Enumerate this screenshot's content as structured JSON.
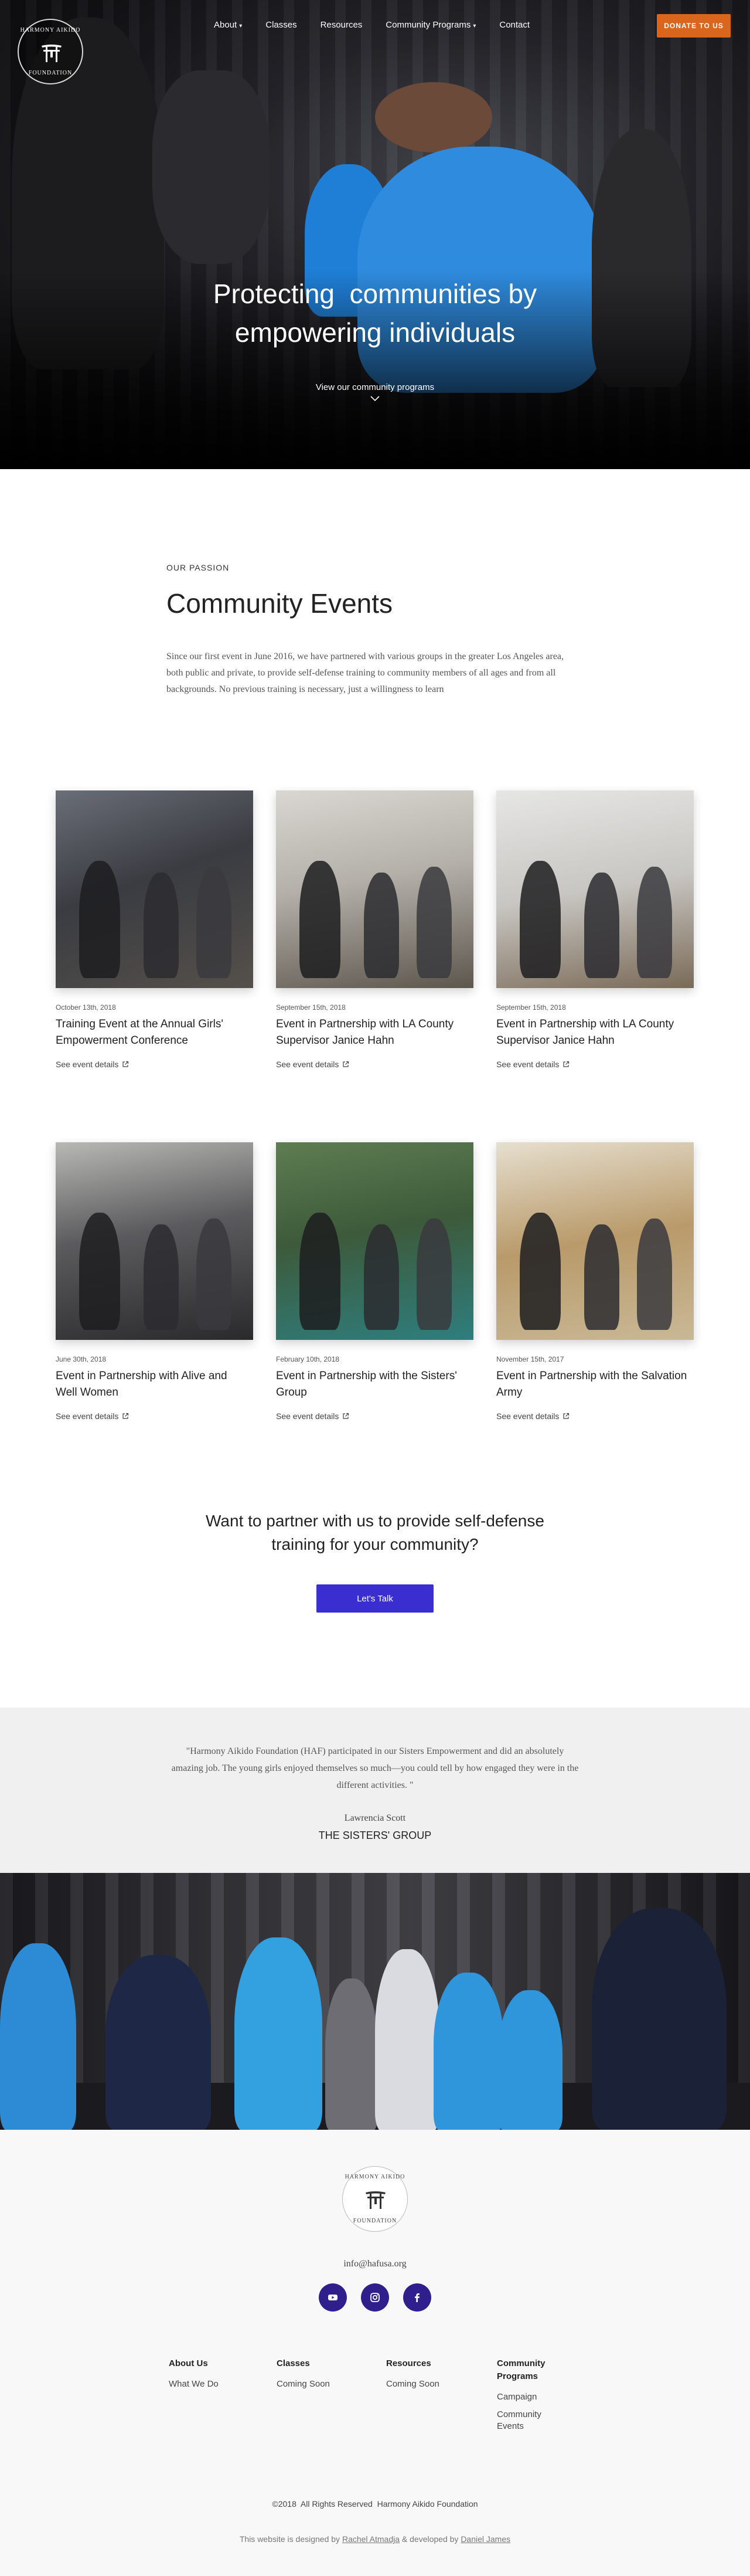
{
  "brand": {
    "logo_top": "HARMONY AIKIDO",
    "logo_bottom": "FOUNDATION"
  },
  "nav": {
    "items": [
      {
        "label": "About",
        "has_dropdown": true
      },
      {
        "label": "Classes",
        "has_dropdown": false
      },
      {
        "label": "Resources",
        "has_dropdown": false
      },
      {
        "label": "Community Programs",
        "has_dropdown": true
      },
      {
        "label": "Contact",
        "has_dropdown": false
      }
    ],
    "dropdown_glyph": "▾",
    "donate_label": "DONATE TO US",
    "donate_color": "#d9661c"
  },
  "hero": {
    "title_line1": "Protecting  communities by",
    "title_line2": "empowering individuals",
    "link_label": "View our community programs"
  },
  "events": {
    "kicker": "OUR PASSION",
    "title": "Community Events",
    "description": "Since our first event in June 2016, we have partnered with various groups in the greater Los Angeles area, both public and private, to provide self-defense training to community members of all ages and from all backgrounds. No previous training is necessary, just a willingness to learn",
    "more_label": "See event details",
    "cards": [
      {
        "date": "October 13th, 2018",
        "title": "Training Event at the Annual Girls' Empowerment Conference"
      },
      {
        "date": "September 15th, 2018",
        "title": "Event in Partnership with LA County Supervisor Janice Hahn"
      },
      {
        "date": "September 15th, 2018",
        "title": "Event in Partnership with LA County Supervisor Janice Hahn"
      },
      {
        "date": "June 30th, 2018",
        "title": "Event in Partnership with Alive and Well Women"
      },
      {
        "date": "February 10th, 2018",
        "title": "Event in Partnership with the Sisters' Group"
      },
      {
        "date": "November 15th, 2017",
        "title": "Event in Partnership with the Salvation Army"
      }
    ]
  },
  "cta": {
    "title_line1": "Want to partner with us to provide self-defense",
    "title_line2": "training for your community?",
    "button_label": "Let's Talk",
    "button_color": "#3b2ed0"
  },
  "testimonial": {
    "quote": "\"Harmony Aikido Foundation (HAF) participated in our Sisters Empowerment and did an absolutely amazing job. The young girls enjoyed themselves so much—you could tell by how engaged they were in the different activities. \"",
    "name": "Lawrencia Scott",
    "organization": "THE SISTERS' GROUP"
  },
  "footer": {
    "email": "info@hafusa.org",
    "socials": [
      {
        "name": "youtube-icon"
      },
      {
        "name": "instagram-icon"
      },
      {
        "name": "facebook-icon"
      }
    ],
    "social_color": "#2f1f8c",
    "columns": [
      {
        "heading": "About Us",
        "links": [
          "What We Do"
        ]
      },
      {
        "heading": "Classes",
        "links": [
          "Coming Soon"
        ]
      },
      {
        "heading": "Resources",
        "links": [
          "Coming Soon"
        ]
      },
      {
        "heading": "Community Programs",
        "links": [
          "Campaign",
          "Community Events"
        ]
      }
    ],
    "copyright": "©2018  All Rights Reserved  Harmony Aikido Foundation",
    "credit_prefix": "This website is designed by ",
    "designer": "Rachel Atmadja",
    "credit_mid": " & developed by ",
    "developer": "Daniel James"
  }
}
